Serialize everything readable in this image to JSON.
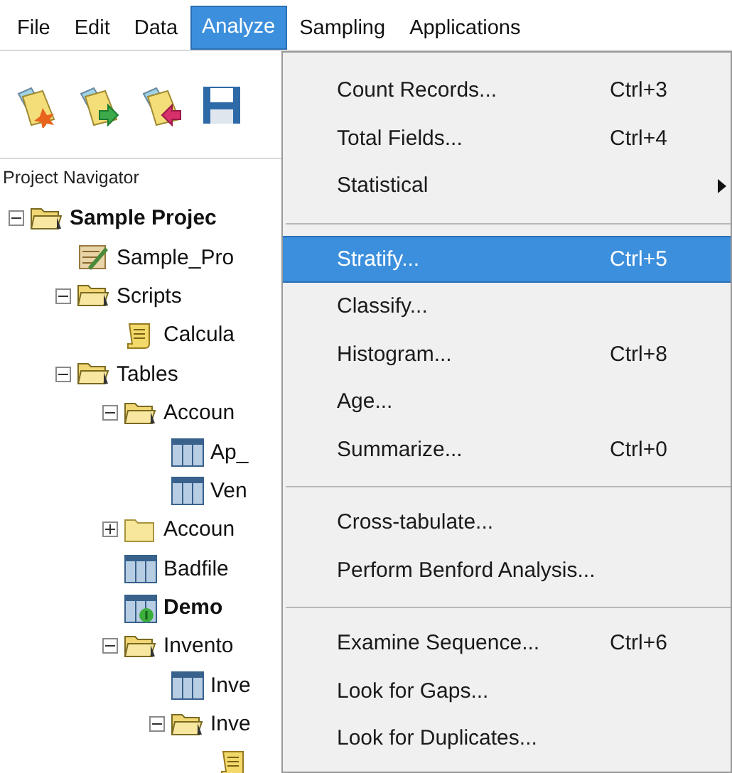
{
  "menubar": [
    {
      "label": "File",
      "selected": false
    },
    {
      "label": "Edit",
      "selected": false
    },
    {
      "label": "Data",
      "selected": false
    },
    {
      "label": "Analyze",
      "selected": true
    },
    {
      "label": "Sampling",
      "selected": false
    },
    {
      "label": "Applications",
      "selected": false
    }
  ],
  "navigator": {
    "title": "Project Navigator",
    "tree": [
      {
        "label": "Sample Projec",
        "kind": "folder",
        "bold": true,
        "expanded": true,
        "children": [
          {
            "label": "Sample_Pro",
            "kind": "notes",
            "bold": false
          },
          {
            "label": "Scripts",
            "kind": "folder",
            "bold": false,
            "expanded": true,
            "children": [
              {
                "label": "Calcula",
                "kind": "script",
                "bold": false
              }
            ]
          },
          {
            "label": "Tables",
            "kind": "folder",
            "bold": false,
            "expanded": true,
            "children": [
              {
                "label": "Accoun",
                "kind": "folder",
                "bold": false,
                "expanded": true,
                "children": [
                  {
                    "label": "Ap_",
                    "kind": "table",
                    "bold": false
                  },
                  {
                    "label": "Ven",
                    "kind": "table",
                    "bold": false
                  }
                ]
              },
              {
                "label": "Accoun",
                "kind": "folder",
                "bold": false,
                "expanded": false
              },
              {
                "label": "Badfile",
                "kind": "table",
                "bold": false
              },
              {
                "label": "Demo",
                "kind": "open-table",
                "bold": true
              },
              {
                "label": "Invento",
                "kind": "folder",
                "bold": false,
                "expanded": true,
                "children": [
                  {
                    "label": "Inve",
                    "kind": "table",
                    "bold": false
                  },
                  {
                    "label": "Inve",
                    "kind": "folder",
                    "bold": false,
                    "expanded": true,
                    "children": [
                      {
                        "kind": "script"
                      }
                    ]
                  }
                ]
              }
            ]
          }
        ]
      }
    ]
  },
  "menu": [
    {
      "kind": "item",
      "label": "Count Records...",
      "shortcut": "Ctrl+3",
      "selected": false
    },
    {
      "kind": "item",
      "label": "Total Fields...",
      "shortcut": "Ctrl+4",
      "selected": false
    },
    {
      "kind": "submenu",
      "label": "Statistical",
      "selected": false
    },
    {
      "kind": "separator"
    },
    {
      "kind": "item",
      "label": "Stratify...",
      "shortcut": "Ctrl+5",
      "selected": true
    },
    {
      "kind": "item",
      "label": "Classify...",
      "selected": false
    },
    {
      "kind": "item",
      "label": "Histogram...",
      "shortcut": "Ctrl+8",
      "selected": false
    },
    {
      "kind": "item",
      "label": "Age...",
      "selected": false
    },
    {
      "kind": "item",
      "label": "Summarize...",
      "shortcut": "Ctrl+0",
      "selected": false
    },
    {
      "kind": "separator"
    },
    {
      "kind": "item",
      "label": "Cross-tabulate...",
      "selected": false
    },
    {
      "kind": "item",
      "label": "Perform Benford Analysis...",
      "selected": false
    },
    {
      "kind": "separator"
    },
    {
      "kind": "item",
      "label": "Examine Sequence...",
      "shortcut": "Ctrl+6",
      "selected": false
    },
    {
      "kind": "item",
      "label": "Look for Gaps...",
      "selected": false
    },
    {
      "kind": "item",
      "label": "Look for Duplicates...",
      "selected": false
    }
  ]
}
